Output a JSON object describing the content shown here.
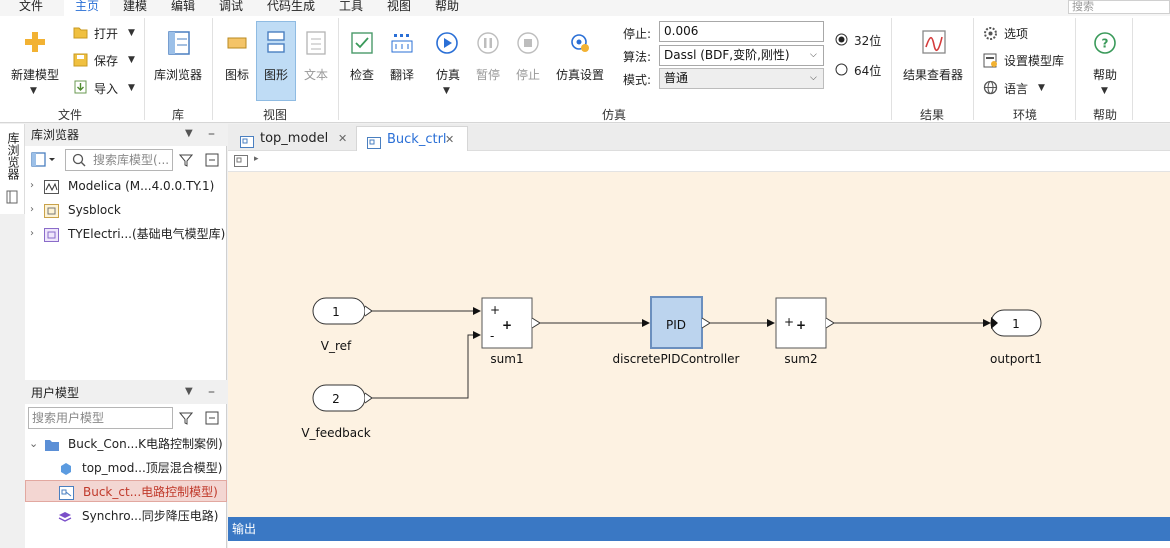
{
  "menu": [
    "文件",
    "主页",
    "建模",
    "编辑",
    "调试",
    "代码生成",
    "工具",
    "视图",
    "帮助"
  ],
  "search_placeholder": "搜索",
  "ribbon": {
    "groups": {
      "file": "文件",
      "library": "库",
      "view": "视图",
      "simulation": "仿真",
      "result": "结果",
      "environment": "环境",
      "help": "帮助"
    },
    "file": {
      "new_model": "新建模型",
      "open": "打开",
      "save": "保存",
      "import": "导入"
    },
    "library": {
      "browser": "库浏览器"
    },
    "view": {
      "icon": "图标",
      "diagram": "图形",
      "text": "文本",
      "active": "diagram"
    },
    "sim": {
      "check": "检查",
      "translate": "翻译",
      "simulate": "仿真",
      "pause": "暂停",
      "stop": "停止",
      "settings": "仿真设置",
      "stop_time_label": "停止:",
      "stop_time_value": "0.006",
      "algorithm_label": "算法:",
      "algorithm_value": "Dassl (BDF,变阶,刚性)",
      "mode_label": "模式:",
      "mode_value": "普通",
      "bit32": "32位",
      "bit64": "64位",
      "selected_bits": "32位"
    },
    "result": {
      "viewer": "结果查看器"
    },
    "env": {
      "options": "选项",
      "set_library": "设置模型库",
      "language": "语言"
    },
    "help": {
      "help": "帮助"
    }
  },
  "sidebar": {
    "vertical_tab": "库浏览器"
  },
  "library_panel": {
    "title": "库浏览器",
    "search_placeholder": "搜索库模型(...",
    "items": [
      "Modelica (M...4.0.0.TY.1)",
      "Sysblock",
      "TYElectri...(基础电气模型库)"
    ]
  },
  "user_panel": {
    "title": "用户模型",
    "search_placeholder": "搜索用户模型",
    "items": [
      "Buck_Con...K电路控制案例)",
      "top_mod...顶层混合模型)",
      "Buck_ct...电路控制模型)",
      "Synchro...同步降压电路)"
    ],
    "selected": "Buck_ct...电路控制模型)"
  },
  "editor": {
    "tabs": [
      "top_model",
      "Buck_ctrl"
    ],
    "active_tab": "Buck_ctrl"
  },
  "diagram": {
    "vref": {
      "number": "1",
      "label": "V_ref"
    },
    "vfeedback": {
      "number": "2",
      "label": "V_feedback"
    },
    "sum1": {
      "op": "+",
      "sign_top": "+",
      "sign_bottom": "-",
      "label": "sum1"
    },
    "pid": {
      "text": "PID",
      "label": "discretePIDController"
    },
    "sum2": {
      "op": "+",
      "sign": "+",
      "label": "sum2"
    },
    "outport": {
      "number": "1",
      "label": "outport1"
    },
    "canvas_color": "#fdf2e2"
  },
  "output": {
    "title": "输出"
  },
  "colors": {
    "accent": "#2a6fd6",
    "output_bar": "#3a78c4",
    "selected_item_text": "#c0392b",
    "pid_fill": "#bcd4ee"
  }
}
